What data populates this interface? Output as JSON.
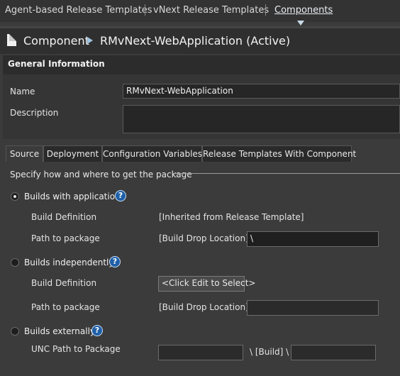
{
  "nav": {
    "tabs": [
      "Agent-based Release Templates",
      "vNext Release Templates",
      "Components"
    ],
    "active_index": 2
  },
  "header": {
    "section": "Component",
    "title": "RMvNext-WebApplication (Active)"
  },
  "general": {
    "title": "General Information",
    "name_label": "Name",
    "name_value": "RMvNext-WebApplication",
    "description_label": "Description",
    "description_value": ""
  },
  "tabs": [
    "Source",
    "Deployment",
    "Configuration Variables",
    "Release Templates With Component"
  ],
  "active_tab": 0,
  "source": {
    "intro": "Specify how and where to get the package",
    "options": [
      {
        "label": "Builds with application",
        "checked": true,
        "build_def_label": "Build Definition",
        "build_def_value": "[Inherited from Release Template]",
        "path_label": "Path to package",
        "path_prefix": "[Build Drop Location] \\",
        "path_value": "\\"
      },
      {
        "label": "Builds independently",
        "checked": false,
        "build_def_label": "Build Definition",
        "build_def_button": "<Click Edit to Select>",
        "path_label": "Path to package",
        "path_prefix": "[Build Drop Location] \\",
        "path_value": ""
      },
      {
        "label": "Builds externally",
        "checked": false,
        "unc_label": "UNC Path to Package",
        "unc_value": "",
        "build_sep": "\\ [Build] \\",
        "build_value": ""
      }
    ]
  },
  "icons": {
    "help": "help-icon",
    "breadcrumb": "arrow-right-icon",
    "component": "document-icon",
    "active_indicator": "triangle-down-icon"
  },
  "colors": {
    "background": "#3b3b3b",
    "header_band": "#2f2f2f",
    "help_icon": "#1f5fa8",
    "accent_arrow": "#9fc3e0"
  }
}
